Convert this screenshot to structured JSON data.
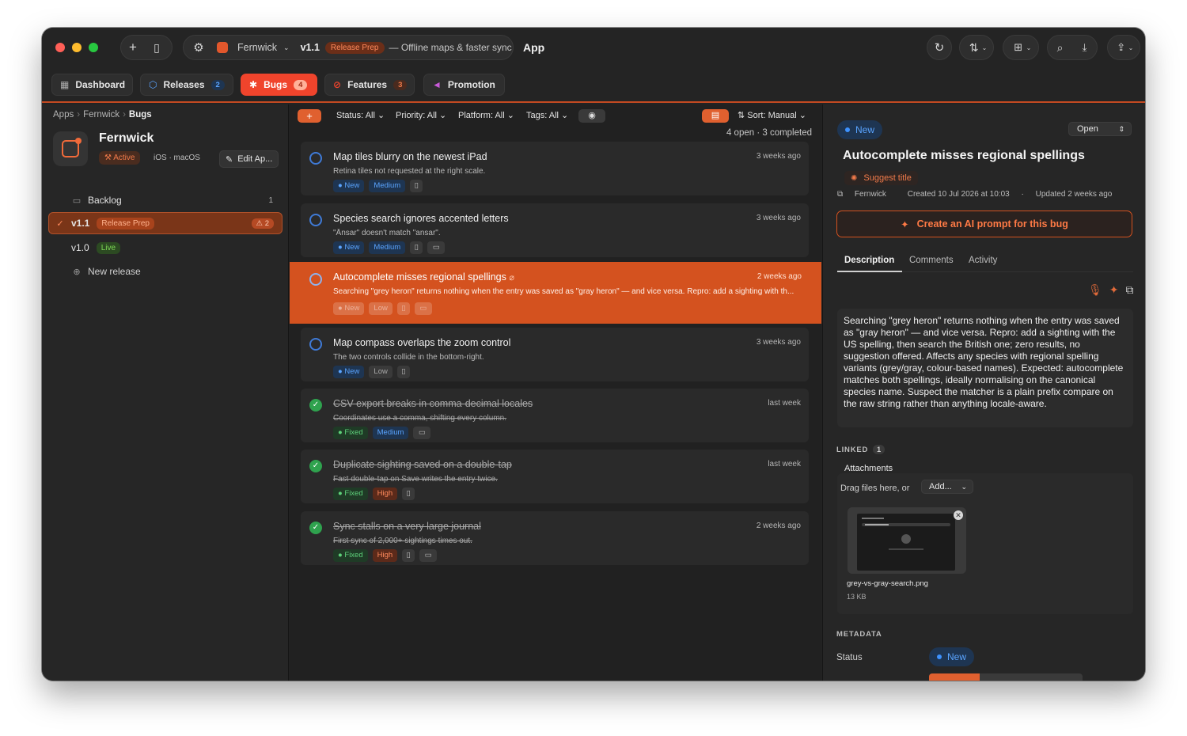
{
  "titlebar": {
    "project": "Fernwick",
    "version": "v1.1",
    "version_status": "Release Prep",
    "version_subtitle": "— Offline maps & faster sync",
    "window_title": "App"
  },
  "tabs": [
    {
      "label": "Dashboard",
      "icon": "grid-icon",
      "count": ""
    },
    {
      "label": "Releases",
      "icon": "cube-icon",
      "count": "2"
    },
    {
      "label": "Bugs",
      "icon": "bug-icon",
      "count": "4"
    },
    {
      "label": "Features",
      "icon": "target-icon",
      "count": "3"
    },
    {
      "label": "Promotion",
      "icon": "megaphone-icon",
      "count": ""
    }
  ],
  "sidebar": {
    "breadcrumb": [
      "Apps",
      "Fernwick",
      "Bugs"
    ],
    "project_name": "Fernwick",
    "project_status": "Active",
    "platforms": "iOS · macOS",
    "edit_label": "Edit Ap...",
    "items": [
      {
        "label": "Backlog",
        "count": "1"
      },
      {
        "label": "v1.1",
        "badge": "Release Prep",
        "warn": "2"
      },
      {
        "label": "v1.0",
        "badge": "Live"
      },
      {
        "label": "New release"
      }
    ]
  },
  "filters": {
    "add": "+",
    "status": "Status: All",
    "priority": "Priority: All",
    "platform": "Platform: All",
    "tags": "Tags: All",
    "sort": "Sort: Manual",
    "counts": "4 open · 3 completed"
  },
  "bugs": [
    {
      "title": "Map tiles blurry on the newest iPad",
      "desc": "Retina tiles not requested at the right scale.",
      "time": "3 weeks ago",
      "status": "New",
      "priority": "Medium"
    },
    {
      "title": "Species search ignores accented letters",
      "desc": "\"Ånsar\" doesn't match \"ansar\".",
      "time": "3 weeks ago",
      "status": "New",
      "priority": "Medium"
    },
    {
      "title": "Autocomplete misses regional spellings",
      "desc": "Searching \"grey heron\" returns nothing when the entry was saved as \"gray heron\" — and vice versa. Repro: add a sighting with th...",
      "time": "2 weeks ago",
      "status": "New",
      "priority": "Low"
    },
    {
      "title": "Map compass overlaps the zoom control",
      "desc": "The two controls collide in the bottom-right.",
      "time": "3 weeks ago",
      "status": "New",
      "priority": "Low"
    },
    {
      "title": "CSV export breaks in comma-decimal locales",
      "desc": "Coordinates use a comma, shifting every column.",
      "time": "last week",
      "status": "Fixed",
      "priority": "Medium"
    },
    {
      "title": "Duplicate sighting saved on a double-tap",
      "desc": "Fast double-tap on Save writes the entry twice.",
      "time": "last week",
      "status": "Fixed",
      "priority": "High"
    },
    {
      "title": "Sync stalls on a very large journal",
      "desc": "First sync of 2,000+ sightings times out.",
      "time": "2 weeks ago",
      "status": "Fixed",
      "priority": "High"
    }
  ],
  "detail": {
    "status": "New",
    "state_select": "Open",
    "title": "Autocomplete misses regional spellings",
    "suggest": "Suggest title",
    "project": "Fernwick",
    "created": "Created 10 Jul 2026 at 10:03",
    "updated": "Updated 2 weeks ago",
    "ai_button": "Create an AI prompt for this bug",
    "tabs": [
      "Description",
      "Comments",
      "Activity"
    ],
    "description": "Searching \"grey heron\" returns nothing when the entry was saved as \"gray heron\" — and vice versa. Repro: add a sighting with the US spelling, then search the British one; zero results, no suggestion offered. Affects any species with regional spelling variants (grey/gray, colour-based names). Expected: autocomplete matches both spellings, ideally normalising on the canonical species name. Suspect the matcher is a plain prefix compare on the raw string rather than anything locale-aware.",
    "linked_label": "LINKED",
    "linked_count": "1",
    "attachments_label": "Attachments",
    "drag_text": "Drag files here, or",
    "add_label": "Add...",
    "file_name": "grey-vs-gray-search.png",
    "file_size": "13 KB",
    "metadata_label": "METADATA",
    "meta_status_label": "Status",
    "meta_status": "New"
  },
  "colors": {
    "accent": "#e0602f",
    "window_bg": "#232323",
    "new_blue": "#5aa4ff",
    "fixed_green": "#5ed17a"
  }
}
